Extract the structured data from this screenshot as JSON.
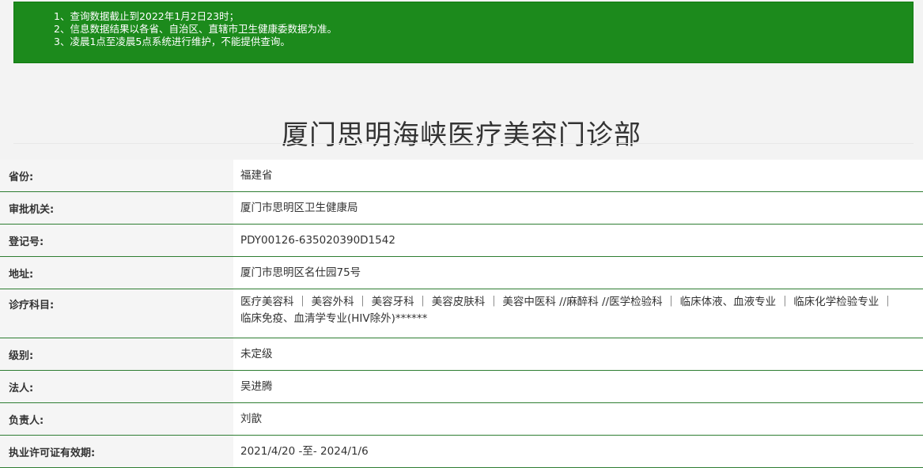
{
  "notice": {
    "lines": [
      "1、查询数据截止到2022年1月2日23时；",
      "2、信息数据结果以各省、自治区、直辖市卫生健康委数据为准。",
      "3、凌晨1点至凌晨5点系统进行维护，不能提供查询。"
    ]
  },
  "page_title": "厦门思明海峡医疗美容门诊部",
  "rows": [
    {
      "label": "省份:",
      "value": "福建省"
    },
    {
      "label": "审批机关:",
      "value": "厦门市思明区卫生健康局"
    },
    {
      "label": "登记号:",
      "value": "PDY00126-635020390D1542"
    },
    {
      "label": "地址:",
      "value": "厦门市思明区名仕园75号"
    },
    {
      "label": "诊疗科目:",
      "value": "医疗美容科 ｜ 美容外科 ｜ 美容牙科 ｜ 美容皮肤科 ｜ 美容中医科 //麻醉科 //医学检验科 ｜ 临床体液、血液专业 ｜ 临床化学检验专业 ｜ 临床免疫、血清学专业(HIV除外)******"
    },
    {
      "label": "级别:",
      "value": "未定级"
    },
    {
      "label": "法人:",
      "value": "吴进腾"
    },
    {
      "label": "负责人:",
      "value": "刘歆"
    },
    {
      "label": "执业许可证有效期:",
      "value": "2021/4/20 -至- 2024/1/6"
    }
  ],
  "colors": {
    "notice_bg": "#1c8a1c",
    "row_border": "#2e7d32"
  }
}
